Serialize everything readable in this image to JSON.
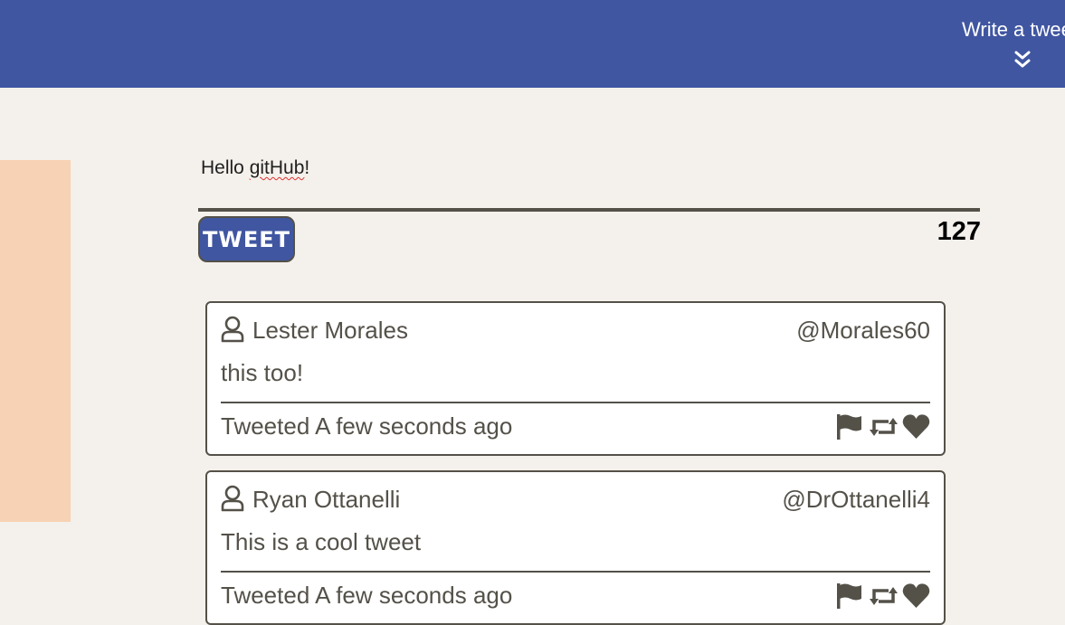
{
  "header": {
    "write_link": "Write a tweet",
    "toggle_icon": "double-chevron-down-icon",
    "bg_color": "#4056a1"
  },
  "compose": {
    "text_plain": "Hello ",
    "text_misspelled": "gitHub",
    "text_tail": "!",
    "tweet_button": "TWEET",
    "char_count": "127"
  },
  "tweets": [
    {
      "name": "Lester Morales",
      "handle": "@Morales60",
      "content": "this too!",
      "time": "Tweeted A few seconds ago",
      "icons": [
        "flag-icon",
        "retweet-icon",
        "heart-icon"
      ]
    },
    {
      "name": "Ryan Ottanelli",
      "handle": "@DrOttanelli4",
      "content": "This is a cool tweet",
      "time": "Tweeted A few seconds ago",
      "icons": [
        "flag-icon",
        "retweet-icon",
        "heart-icon"
      ]
    }
  ],
  "colors": {
    "accent": "#4056a1",
    "text": "#545149",
    "background": "#f4f0eb",
    "side_panel": "#f7d2b4"
  }
}
